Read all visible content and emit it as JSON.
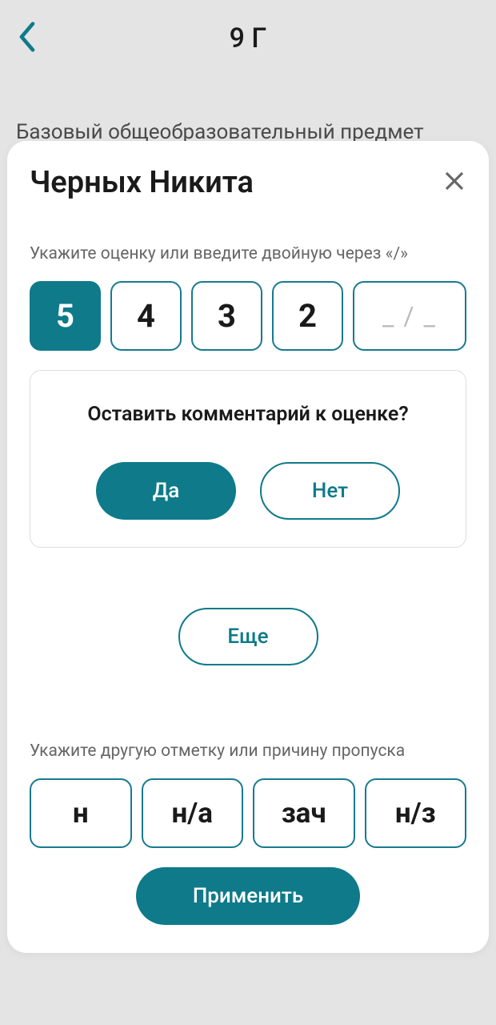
{
  "header": {
    "title": "9 Г"
  },
  "subject": "Базовый общеобразовательный предмет",
  "modal": {
    "title": "Черных Никита",
    "grade_instruction": "Укажите оценку или введите двойную через «/»",
    "grades": [
      "5",
      "4",
      "3",
      "2"
    ],
    "selected_grade_index": 0,
    "dual_placeholder": "_ / _",
    "comment": {
      "prompt": "Оставить комментарий к оценке?",
      "yes": "Да",
      "no": "Нет"
    },
    "more_label": "Еще",
    "mark_instruction": "Укажите другую отметку или причину пропуска",
    "marks": [
      "н",
      "н/а",
      "зач",
      "н/з"
    ],
    "apply_label": "Применить"
  }
}
